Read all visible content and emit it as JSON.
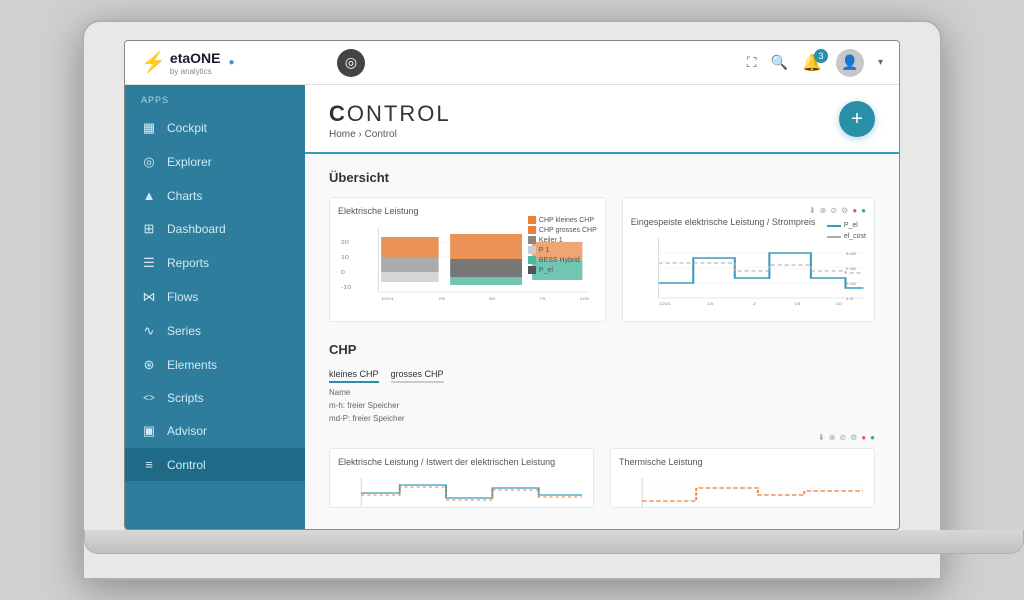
{
  "app": {
    "logo_text": "etaONE",
    "logo_sub": "by analytics",
    "logo_icon": "⚡"
  },
  "topbar": {
    "compass_icon": "◎",
    "expand_icon": "⛶",
    "search_icon": "🔍",
    "bell_icon": "🔔",
    "bell_badge": "3",
    "avatar_icon": "👤"
  },
  "sidebar": {
    "apps_label": "Apps",
    "items": [
      {
        "id": "cockpit",
        "label": "Cockpit",
        "icon": "▦",
        "active": false
      },
      {
        "id": "explorer",
        "label": "Explorer",
        "icon": "◎",
        "active": false
      },
      {
        "id": "charts",
        "label": "Charts",
        "icon": "▲",
        "active": false
      },
      {
        "id": "dashboard",
        "label": "Dashboard",
        "icon": "⊞",
        "active": false
      },
      {
        "id": "reports",
        "label": "Reports",
        "icon": "☰",
        "active": false
      },
      {
        "id": "flows",
        "label": "Flows",
        "icon": "⋈",
        "active": false
      },
      {
        "id": "series",
        "label": "Series",
        "icon": "∿",
        "active": false
      },
      {
        "id": "elements",
        "label": "Elements",
        "icon": "⊛",
        "active": false
      },
      {
        "id": "scripts",
        "label": "Scripts",
        "icon": "<>",
        "active": false
      },
      {
        "id": "advisor",
        "label": "Advisor",
        "icon": "▣",
        "active": false
      },
      {
        "id": "control",
        "label": "Control",
        "icon": "≡",
        "active": true
      }
    ]
  },
  "page": {
    "title": "Control",
    "title_prefix": "C",
    "breadcrumb_home": "Home",
    "breadcrumb_sep": "›",
    "breadcrumb_current": "Control",
    "add_button_label": "+"
  },
  "overview": {
    "section_title": "Übersicht",
    "chart1": {
      "title": "Elektrische Leistung",
      "legend": [
        {
          "label": "CHP kleines CHP",
          "color": "#e8803a"
        },
        {
          "label": "CHP grosses CHP",
          "color": "#e8803a"
        },
        {
          "label": "Keiler 1",
          "color": "#888"
        },
        {
          "label": "P 1",
          "color": "#ccc"
        },
        {
          "label": "BESS Hybrid",
          "color": "#4db8a0"
        },
        {
          "label": "P_el",
          "color": "#555"
        }
      ]
    },
    "chart2": {
      "title": "Eingespeiste elektrische Leistung / Strompreis",
      "legend": [
        {
          "label": "P_el",
          "color": "#3a9abf"
        },
        {
          "label": "el_cost",
          "color": "#aaa"
        }
      ]
    }
  },
  "chp": {
    "section_title": "CHP",
    "tabs": [
      "kleines CHP",
      "grosses CHP"
    ],
    "info_rows": [
      "Name",
      "m-h: freier Speicher",
      "md-P: freier Speicher"
    ],
    "chart_actions_label": "chart actions"
  },
  "bottom_charts": {
    "chart1_title": "Elektrische Leistung / Istwert der elektrischen Leistung",
    "chart2_title": "Thermische Leistung"
  }
}
